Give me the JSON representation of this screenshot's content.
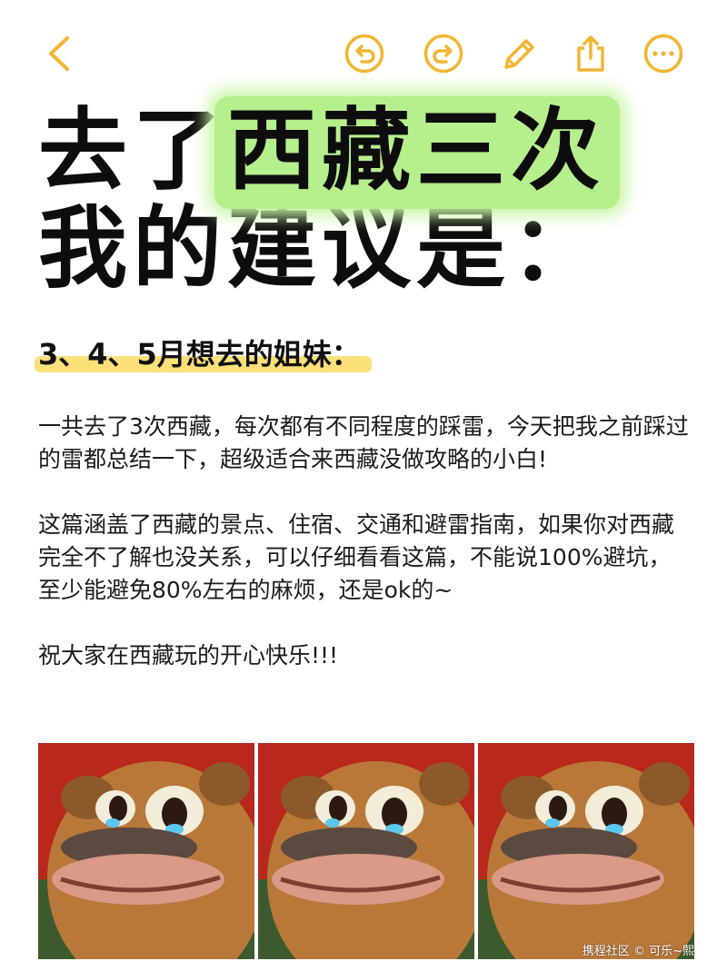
{
  "toolbar": {
    "accent_color": "#F2B533",
    "buttons": [
      {
        "icon": "chevron-left-icon"
      },
      {
        "icon": "undo-icon"
      },
      {
        "icon": "redo-icon"
      },
      {
        "icon": "pencil-icon"
      },
      {
        "icon": "share-icon"
      },
      {
        "icon": "more-icon"
      }
    ]
  },
  "headline": {
    "line1_prefix": "去了",
    "line1_highlight": "西藏三次",
    "line2": "我的建议是："
  },
  "subheading": "3、4、5月想去的姐妹：",
  "paragraphs": [
    "一共去了3次西藏，每次都有不同程度的踩雷，今天把我之前踩过的雷都总结一下，超级适合来西藏没做攻略的小白!",
    "这篇涵盖了西藏的景点、住宿、交通和避雷指南，如果你对西藏完全不了解也没关系，可以仔细看看这篇，不能说100%避坑，至少能避免80%左右的麻烦，还是ok的~",
    "祝大家在西藏玩的开心快乐!!!"
  ],
  "images": [
    {
      "subject": "crying-bear-image"
    },
    {
      "subject": "crying-bear-image"
    },
    {
      "subject": "crying-bear-image"
    }
  ],
  "watermark": "携程社区 © 可乐~熙"
}
